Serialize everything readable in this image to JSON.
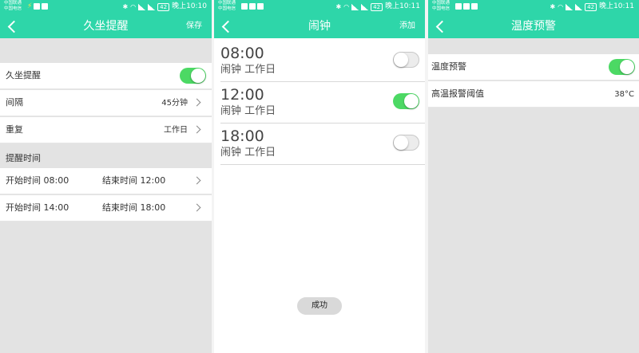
{
  "colors": {
    "accent": "#2ed6a9",
    "toggle_on": "#4cd964",
    "background": "#e3e3e3"
  },
  "screens": [
    {
      "statusbar": {
        "carrier1": "中国联通",
        "carrier2": "中国电信",
        "time": "晚上10:10",
        "battery": "42"
      },
      "header": {
        "title": "久坐提醒",
        "action": "保存"
      },
      "reminder_row": {
        "label": "久坐提醒",
        "enabled": true
      },
      "interval_row": {
        "label": "间隔",
        "value": "45分钟"
      },
      "repeat_row": {
        "label": "重复",
        "value": "工作日"
      },
      "section_label": "提醒时间",
      "time_rows": [
        {
          "start": "开始时间 08:00",
          "end": "结束时间 12:00"
        },
        {
          "start": "开始时间 14:00",
          "end": "结束时间 18:00"
        }
      ]
    },
    {
      "statusbar": {
        "carrier1": "中国联通",
        "carrier2": "中国电信",
        "time": "晚上10:11",
        "battery": "42"
      },
      "header": {
        "title": "闹钟",
        "action": "添加"
      },
      "alarms": [
        {
          "time": "08:00",
          "label": "闹钟 工作日",
          "enabled": false
        },
        {
          "time": "12:00",
          "label": "闹钟 工作日",
          "enabled": true
        },
        {
          "time": "18:00",
          "label": "闹钟 工作日",
          "enabled": false
        }
      ],
      "toast": "成功"
    },
    {
      "statusbar": {
        "carrier1": "中国联通",
        "carrier2": "中国电信",
        "time": "晚上10:11",
        "battery": "42"
      },
      "header": {
        "title": "温度预警"
      },
      "warning_row": {
        "label": "温度预警",
        "enabled": true
      },
      "threshold_row": {
        "label": "高温报警阈值",
        "value": "38°C"
      }
    }
  ]
}
